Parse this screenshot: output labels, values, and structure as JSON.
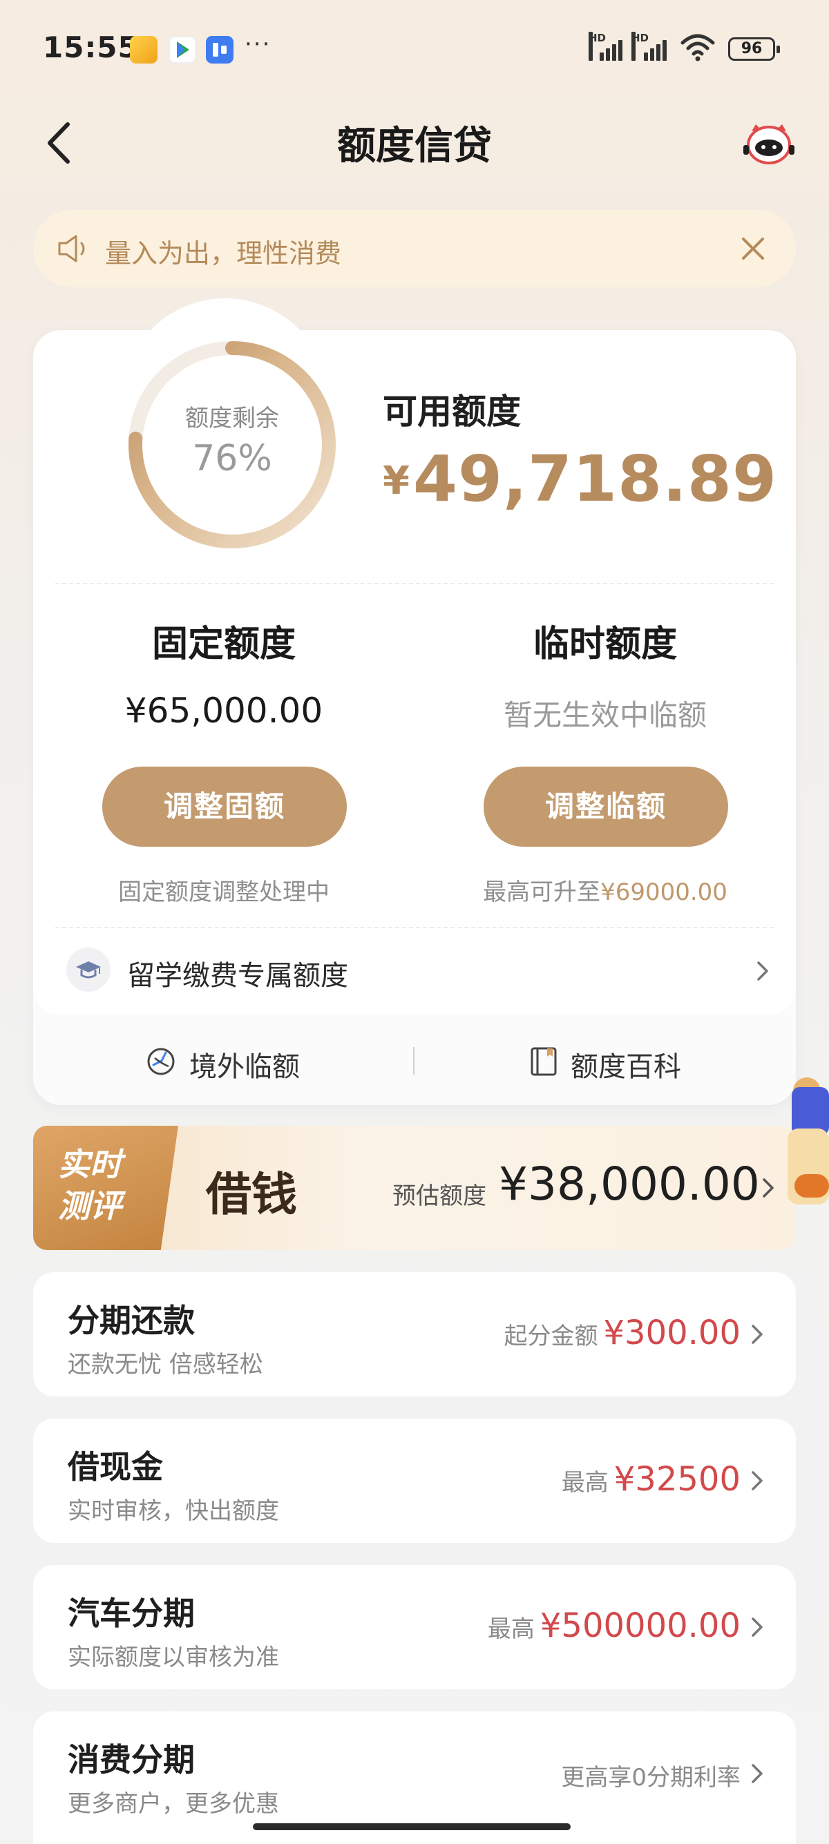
{
  "status_bar": {
    "time": "15:55",
    "more": "···",
    "battery": "96",
    "hd": "HD"
  },
  "header": {
    "title": "额度信贷"
  },
  "notice": {
    "text": "量入为出，理性消费"
  },
  "credit": {
    "remaining_label": "额度剩余",
    "remaining_percent": "76%",
    "remaining_fraction": 0.76,
    "available_label": "可用额度",
    "available_currency": "¥",
    "available_value": "49,718.89"
  },
  "fixed": {
    "title": "固定额度",
    "value": "¥65,000.00",
    "button": "调整固额",
    "note": "固定额度调整处理中"
  },
  "temporary": {
    "title": "临时额度",
    "status": "暂无生效中临额",
    "button": "调整临额",
    "note_prefix": "最高可升至",
    "note_amount": "¥69000.00"
  },
  "study": {
    "label": "留学缴费专属额度"
  },
  "quick_links": {
    "overseas": "境外临额",
    "wiki": "额度百科"
  },
  "banner": {
    "tag_line1": "实时",
    "tag_line2": "测评",
    "title": "借钱",
    "est_label": "预估额度",
    "est_value": "¥38,000.00"
  },
  "items": [
    {
      "title": "分期还款",
      "subtitle": "还款无忧 倍感轻松",
      "label": "起分金额",
      "amount": "¥300.00"
    },
    {
      "title": "借现金",
      "subtitle": "实时审核，快出额度",
      "label": "最高",
      "amount": "¥32500"
    },
    {
      "title": "汽车分期",
      "subtitle": "实际额度以审核为准",
      "label": "最高",
      "amount": "¥500000.00"
    },
    {
      "title": "消费分期",
      "subtitle": "更多商户，更多优惠",
      "label": "更高享0分期利率"
    }
  ],
  "colors": {
    "gold": "#c39b6f",
    "red": "#d2494c",
    "notice_bg": "#fcf1df"
  }
}
